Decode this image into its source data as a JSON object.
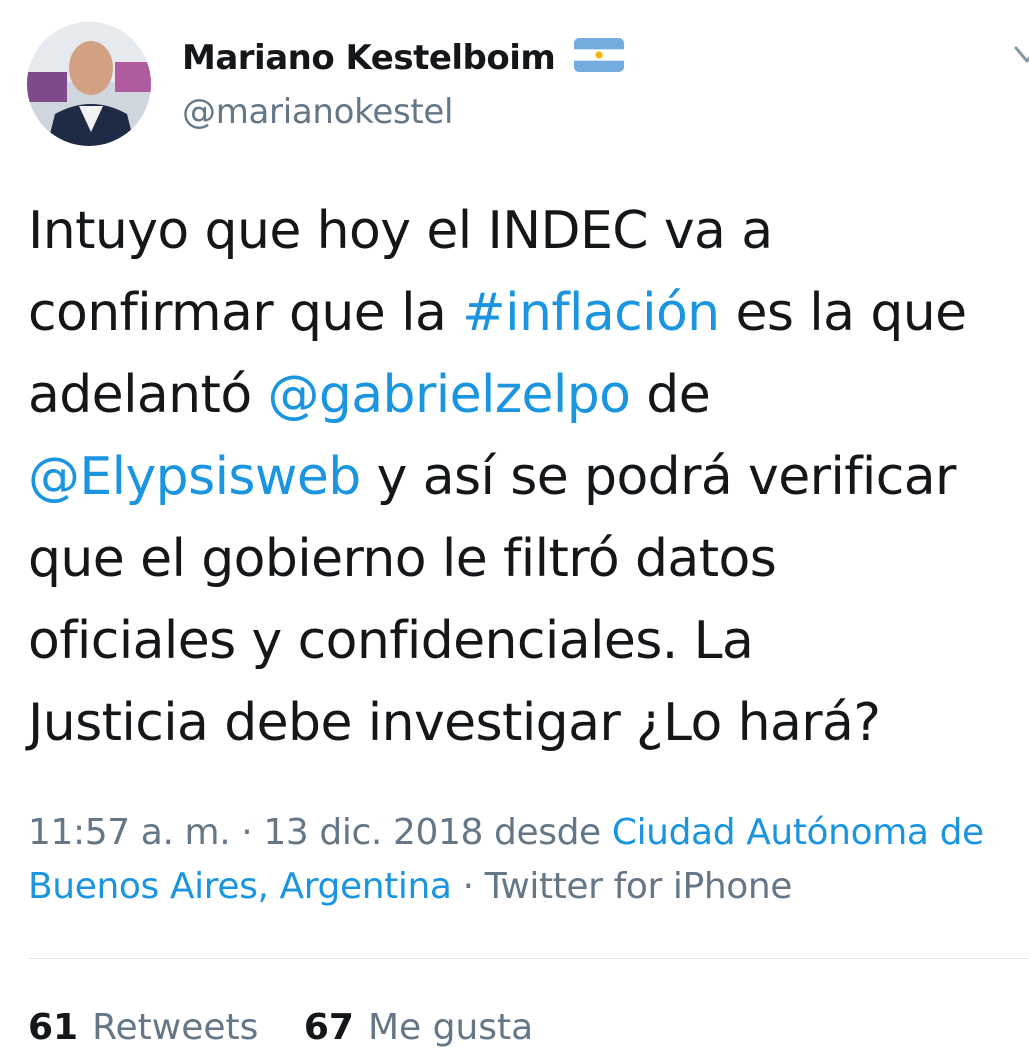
{
  "author": {
    "display_name": "Mariano Kestelboim",
    "handle": "@marianokestel",
    "avatar": "avatar",
    "flag_icon": "argentina-flag-icon"
  },
  "tweet": {
    "line1": "Intuyo que hoy el INDEC va a",
    "line2_pre": "confirmar que la ",
    "line2_hashtag": "#inflación",
    "line2_post": " es la que",
    "line3_pre": "adelantó ",
    "line3_mention": "@gabrielzelpo",
    "line3_post": " de",
    "line4_mention": "@Elypsisweb",
    "line4_post": " y así se podrá verificar",
    "line5": "que el gobierno le filtró datos",
    "line6": "oficiales y confidenciales. La",
    "line7": "Justicia debe investigar ¿Lo hará?"
  },
  "meta": {
    "time_date": "11:57 a. m. · 13 dic. 2018 desde ",
    "location_part1": "Ciudad Autónoma de",
    "location_part2": "Buenos Aires, Argentina",
    "separator": " · ",
    "source": "Twitter for iPhone"
  },
  "stats": {
    "retweets_count": "61",
    "retweets_label": "Retweets",
    "likes_count": "67",
    "likes_label": "Me gusta"
  },
  "colors": {
    "link": "#1b95e0",
    "secondary_text": "#657786",
    "primary_text": "#14171a"
  }
}
